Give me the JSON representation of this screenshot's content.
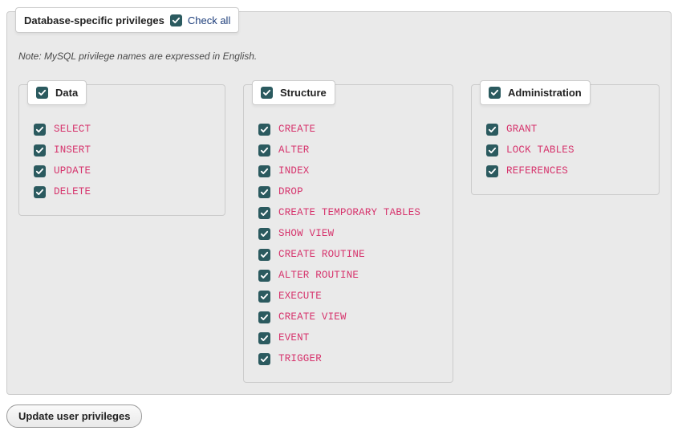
{
  "fieldset": {
    "title": "Database-specific privileges",
    "check_all_label": "Check all",
    "note": "Note: MySQL privilege names are expressed in English."
  },
  "groups": {
    "data": {
      "title": "Data",
      "items": [
        "SELECT",
        "INSERT",
        "UPDATE",
        "DELETE"
      ]
    },
    "structure": {
      "title": "Structure",
      "items": [
        "CREATE",
        "ALTER",
        "INDEX",
        "DROP",
        "CREATE TEMPORARY TABLES",
        "SHOW VIEW",
        "CREATE ROUTINE",
        "ALTER ROUTINE",
        "EXECUTE",
        "CREATE VIEW",
        "EVENT",
        "TRIGGER"
      ]
    },
    "admin": {
      "title": "Administration",
      "items": [
        "GRANT",
        "LOCK TABLES",
        "REFERENCES"
      ]
    }
  },
  "button": {
    "update_label": "Update user privileges"
  },
  "colors": {
    "checkbox_bg": "#2b5a5f",
    "priv_text": "#d6336c",
    "link": "#1c3d7a"
  }
}
